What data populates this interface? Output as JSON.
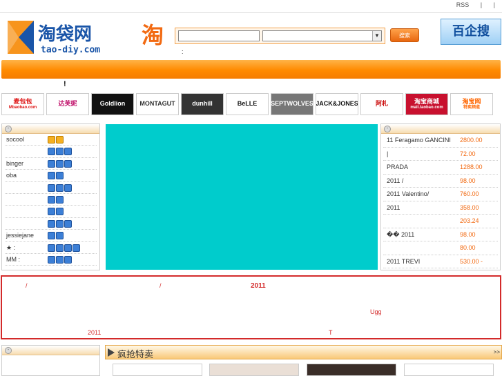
{
  "toplinks": {
    "rss": "RSS",
    "sep1": "|",
    "sep2": "|"
  },
  "logo": {
    "name": "淘袋网",
    "domain": "tao-diy.com"
  },
  "search": {
    "icon_char": "淘",
    "button": "搜索",
    "hint": ":"
  },
  "bqs": {
    "label": "百企搜"
  },
  "notice": {
    "mark": "!"
  },
  "brands": [
    {
      "label": "麦包包",
      "sub": "Mbaobao.com",
      "color": "#d11"
    },
    {
      "label": "达芙妮",
      "color": "#c1126b"
    },
    {
      "label": "Goldlion",
      "color": "#fff",
      "bg": "#111"
    },
    {
      "label": "MONTAGUT",
      "color": "#333"
    },
    {
      "label": "dunhill",
      "color": "#fff",
      "bg": "#333"
    },
    {
      "label": "BeLLE",
      "color": "#111"
    },
    {
      "label": "SEPTWOLVES",
      "color": "#fff",
      "bg": "#777"
    },
    {
      "label": "JACK&JONES",
      "color": "#111"
    },
    {
      "label": "阿札",
      "color": "#c11"
    },
    {
      "label": "淘宝商城",
      "sub": "mall.taobao.com",
      "color": "#fff",
      "bg": "#c8102e"
    },
    {
      "label": "淘宝网",
      "sub": "特卖频道",
      "color": "#f60"
    }
  ],
  "ranking": [
    {
      "name": "socool",
      "crowns": 2,
      "gold": true
    },
    {
      "name": "",
      "crowns": 3
    },
    {
      "name": "binger",
      "crowns": 3
    },
    {
      "name": "oba",
      "crowns": 2
    },
    {
      "name": "",
      "crowns": 3
    },
    {
      "name": "",
      "crowns": 2
    },
    {
      "name": "",
      "crowns": 2
    },
    {
      "name": "",
      "crowns": 3
    },
    {
      "name": "jessiejane",
      "crowns": 2
    },
    {
      "name": "★  :",
      "crowns": 4
    },
    {
      "name": "MM  :",
      "crowns": 3
    }
  ],
  "products": [
    {
      "title": "11   Feragamo GANCINI",
      "price": "2800.00"
    },
    {
      "title": "   |",
      "price": "72.00"
    },
    {
      "title": "PRADA",
      "price": "1288.00"
    },
    {
      "title": "2011          /",
      "price": "98.00"
    },
    {
      "title": "2011 Valentino/",
      "price": "760.00"
    },
    {
      "title": " 2011",
      "price": "358.00"
    },
    {
      "title": "",
      "price": "203.24"
    },
    {
      "title": "��   2011",
      "price": "98.00"
    },
    {
      "title": "",
      "price": "80.00"
    },
    {
      "title": "2011  TREVI",
      "price": "530.00 -"
    }
  ],
  "promo": {
    "slash1": "/",
    "slash2": "/",
    "year": "2011",
    "ugg": "Ugg",
    "year2": "2011",
    "t": "T"
  },
  "bottom": {
    "section_label": "疯抢特卖",
    "more": ">>"
  },
  "colors": {
    "accent": "#ff8a00",
    "price": "#f26a12",
    "alert": "#d32a2a",
    "banner": "#00cccc"
  }
}
